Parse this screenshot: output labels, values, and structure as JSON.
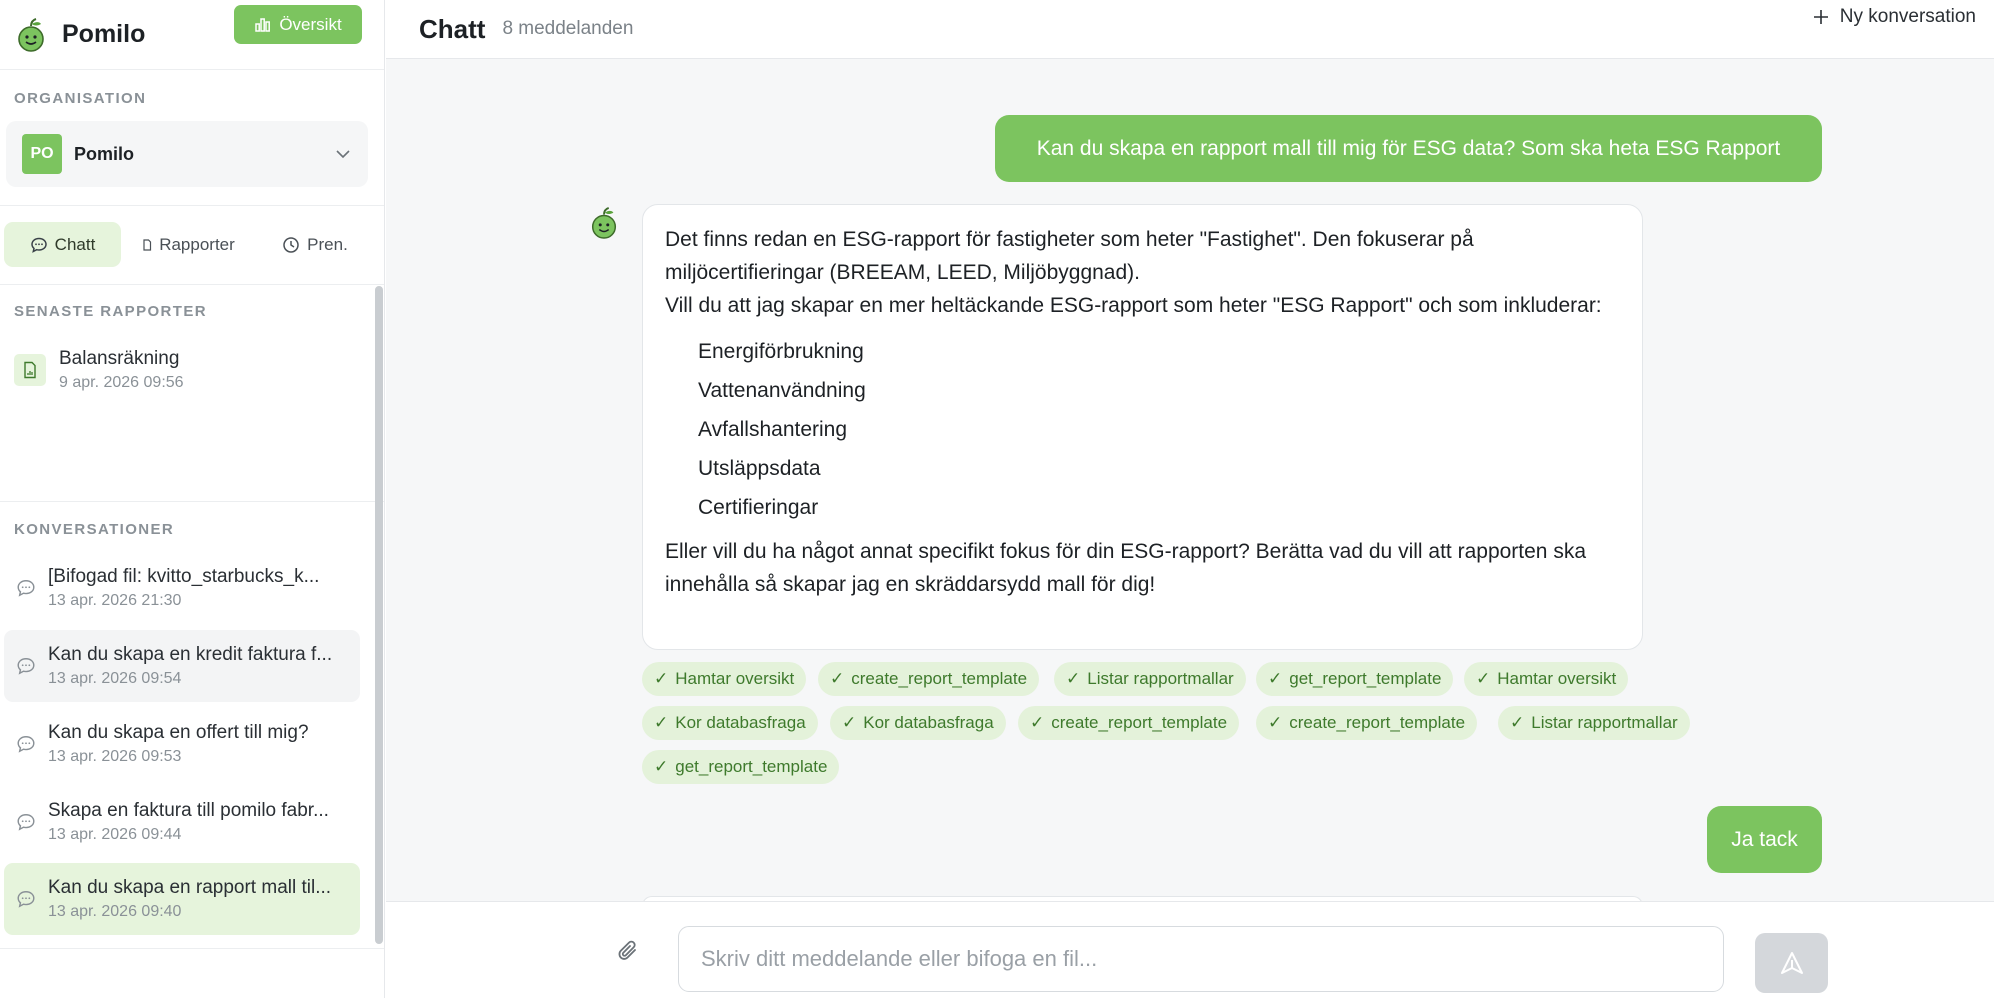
{
  "app": {
    "name": "Pomilo",
    "overview_label": "Översikt"
  },
  "sidebar": {
    "organization_heading": "ORGANISATION",
    "organization": {
      "initials": "PO",
      "name": "Pomilo"
    },
    "tabs": [
      {
        "label": "Chatt",
        "icon": "chat-icon",
        "active": true
      },
      {
        "label": "Rapporter",
        "icon": "report-icon",
        "active": false
      },
      {
        "label": "Pren.",
        "icon": "clock-icon",
        "active": false
      }
    ],
    "recent_reports_heading": "SENASTE RAPPORTER",
    "recent_reports": [
      {
        "title": "Balansräkning",
        "time": "9 apr. 2026 09:56"
      }
    ],
    "conversations_heading": "KONVERSATIONER",
    "conversations": [
      {
        "title": "[Bifogad fil: kvitto_starbucks_k...",
        "time": "13 apr. 2026 21:30",
        "state": "normal"
      },
      {
        "title": "Kan du skapa en kredit faktura f...",
        "time": "13 apr. 2026 09:54",
        "state": "hover"
      },
      {
        "title": "Kan du skapa en offert till mig?",
        "time": "13 apr. 2026 09:53",
        "state": "normal"
      },
      {
        "title": "Skapa en faktura till pomilo fabr...",
        "time": "13 apr. 2026 09:44",
        "state": "normal"
      },
      {
        "title": "Kan du skapa en rapport mall til...",
        "time": "13 apr. 2026 09:40",
        "state": "active"
      }
    ]
  },
  "header": {
    "title": "Chatt",
    "message_count": "8 meddelanden",
    "new_conversation": "Ny konversation"
  },
  "messages": {
    "user_1": "Kan du skapa en rapport mall till mig för ESG data? Som ska heta ESG Rapport",
    "bot_1": {
      "intro": "Det finns redan en ESG-rapport för fastigheter som heter \"Fastighet\". Den fokuserar på miljöcertifieringar (BREEAM, LEED, Miljöbyggnad).",
      "question": "Vill du att jag skapar en mer heltäckande ESG-rapport som heter \"ESG Rapport\" och som inkluderar:",
      "list": [
        "Energiförbrukning",
        "Vattenanvändning",
        "Avfallshantering",
        "Utsläppsdata",
        "Certifieringar"
      ],
      "outro": "Eller vill du ha något annat specifikt fokus för din ESG-rapport? Berätta vad du vill att rapporten ska innehålla så skapar jag en skräddarsydd mall för dig!"
    },
    "tool_chips": [
      "Hamtar oversikt",
      "create_report_template",
      "Listar rapportmallar",
      "get_report_template",
      "Hamtar oversikt",
      "Kor databasfraga",
      "Kor databasfraga",
      "create_report_template",
      "create_report_template",
      "Listar rapportmallar",
      "get_report_template"
    ],
    "chip_check": "✓",
    "user_2": "Ja tack"
  },
  "composer": {
    "placeholder": "Skriv ditt meddelande eller bifoga en fil..."
  },
  "colors": {
    "accent": "#7cc45f",
    "accent_light": "#e6f4dc",
    "chip_text": "#3e7a2c",
    "send_disabled": "#d4d7db"
  }
}
